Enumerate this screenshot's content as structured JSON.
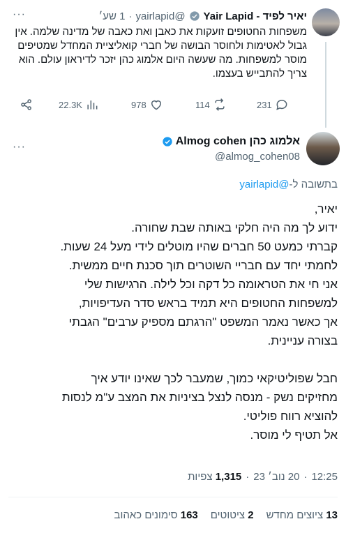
{
  "parent": {
    "name": "יאיר לפיד - Yair Lapid",
    "handle": "@yairlapid",
    "time": "1 שע׳",
    "text": "משפחות החטופים זועקות את כאבן ואת כאבה של מדינה שלמה. אין גבול לאטימות ולחוסר הבושה של חברי קואליציית המחדל שמטיפים מוסר למשפחות. מה שעשה היום אלמוג כהן יזכר לדיראון עולם. הוא צריך להתבייש בעצמו.",
    "stats": {
      "replies": "231",
      "retweets": "114",
      "likes": "978",
      "views": "22.3K"
    }
  },
  "main": {
    "name": "אלמוג כהן Almog cohen",
    "handle": "@almog_cohen08",
    "reply_prefix": "בתשובה ל-",
    "reply_to": "@yairlapid",
    "paragraph1": [
      "יאיר,",
      "ידוע לך מה היה חלקי באותה שבת שחורה.",
      "קברתי כמעט 50 חברים שהיו מוטלים לידי מעל 24 שעות.",
      "לחמתי יחד עם חבריי השוטרים תוך סכנת חיים ממשית.",
      "אני חי את הטראומה כל דקה וכל לילה. הרגישות שלי",
      "למשפחות החטופים היא תמיד בראש סדר העדיפויות,",
      "אך כאשר נאמר המשפט \"הרגתם מספיק ערבים\" הגבתי",
      "בצורה עניינית."
    ],
    "paragraph2": [
      "חבל שפוליטיקאי כמוך, שמעבר לכך שאינו יודע איך",
      "מחזיקים נשק - מנסה לנצל בציניות את המצב ע\"מ לנסות",
      "להוציא רווח פוליטי.",
      "אל תטיף לי מוסר."
    ],
    "time": "12:25",
    "date": "20 נוב׳ 23",
    "views_count": "1,315",
    "views_label": "צפיות"
  },
  "engagement": {
    "quotes_count": "13",
    "quotes_label": "ציוצים מחדש",
    "retweets_count": "2",
    "retweets_label": "ציטוטים",
    "likes_count": "163",
    "likes_label": "סימונים כאהוב"
  },
  "colors": {
    "accent": "#1d9bf0",
    "muted": "#536471",
    "text": "#0f1419"
  }
}
